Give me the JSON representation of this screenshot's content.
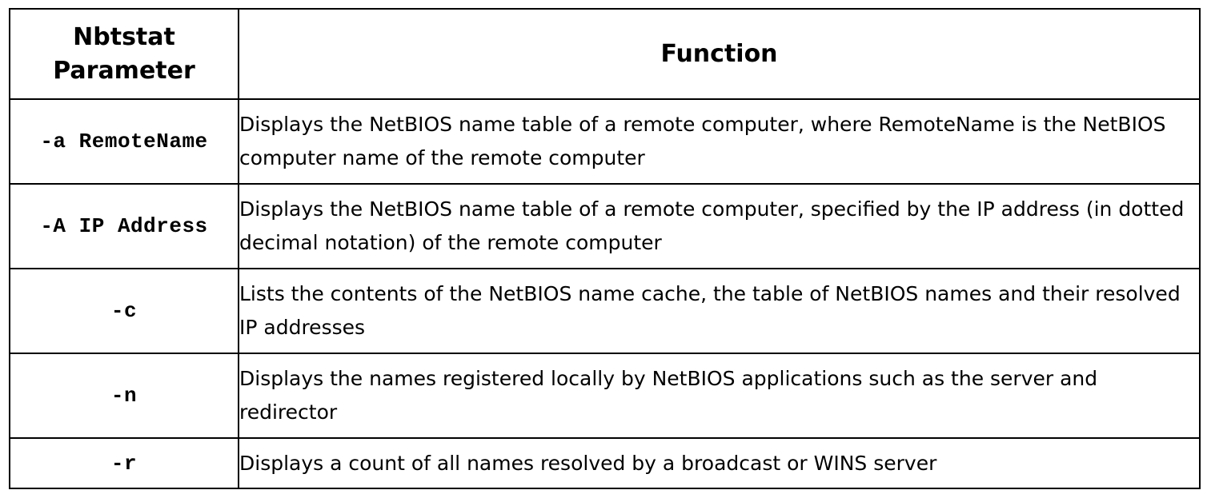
{
  "table": {
    "header": {
      "param_line1": "Nbtstat",
      "param_line2": "Parameter",
      "function": "Function"
    },
    "rows": [
      {
        "param": "-a RemoteName",
        "function": "Displays the NetBIOS name table of a remote computer, where RemoteName is the NetBIOS computer name of the remote computer"
      },
      {
        "param": "-A IP Address",
        "function": "Displays the NetBIOS name table of a remote computer, specified by the IP address (in dotted decimal notation) of the remote computer"
      },
      {
        "param": "-c",
        "function": "Lists the contents of the NetBIOS name cache, the table of NetBIOS names and their resolved IP addresses"
      },
      {
        "param": "-n",
        "function": "Displays the names registered locally by NetBIOS applications such as the server and redirector"
      },
      {
        "param": "-r",
        "function": "Displays a count of all names resolved by a broadcast or WINS server"
      }
    ]
  }
}
